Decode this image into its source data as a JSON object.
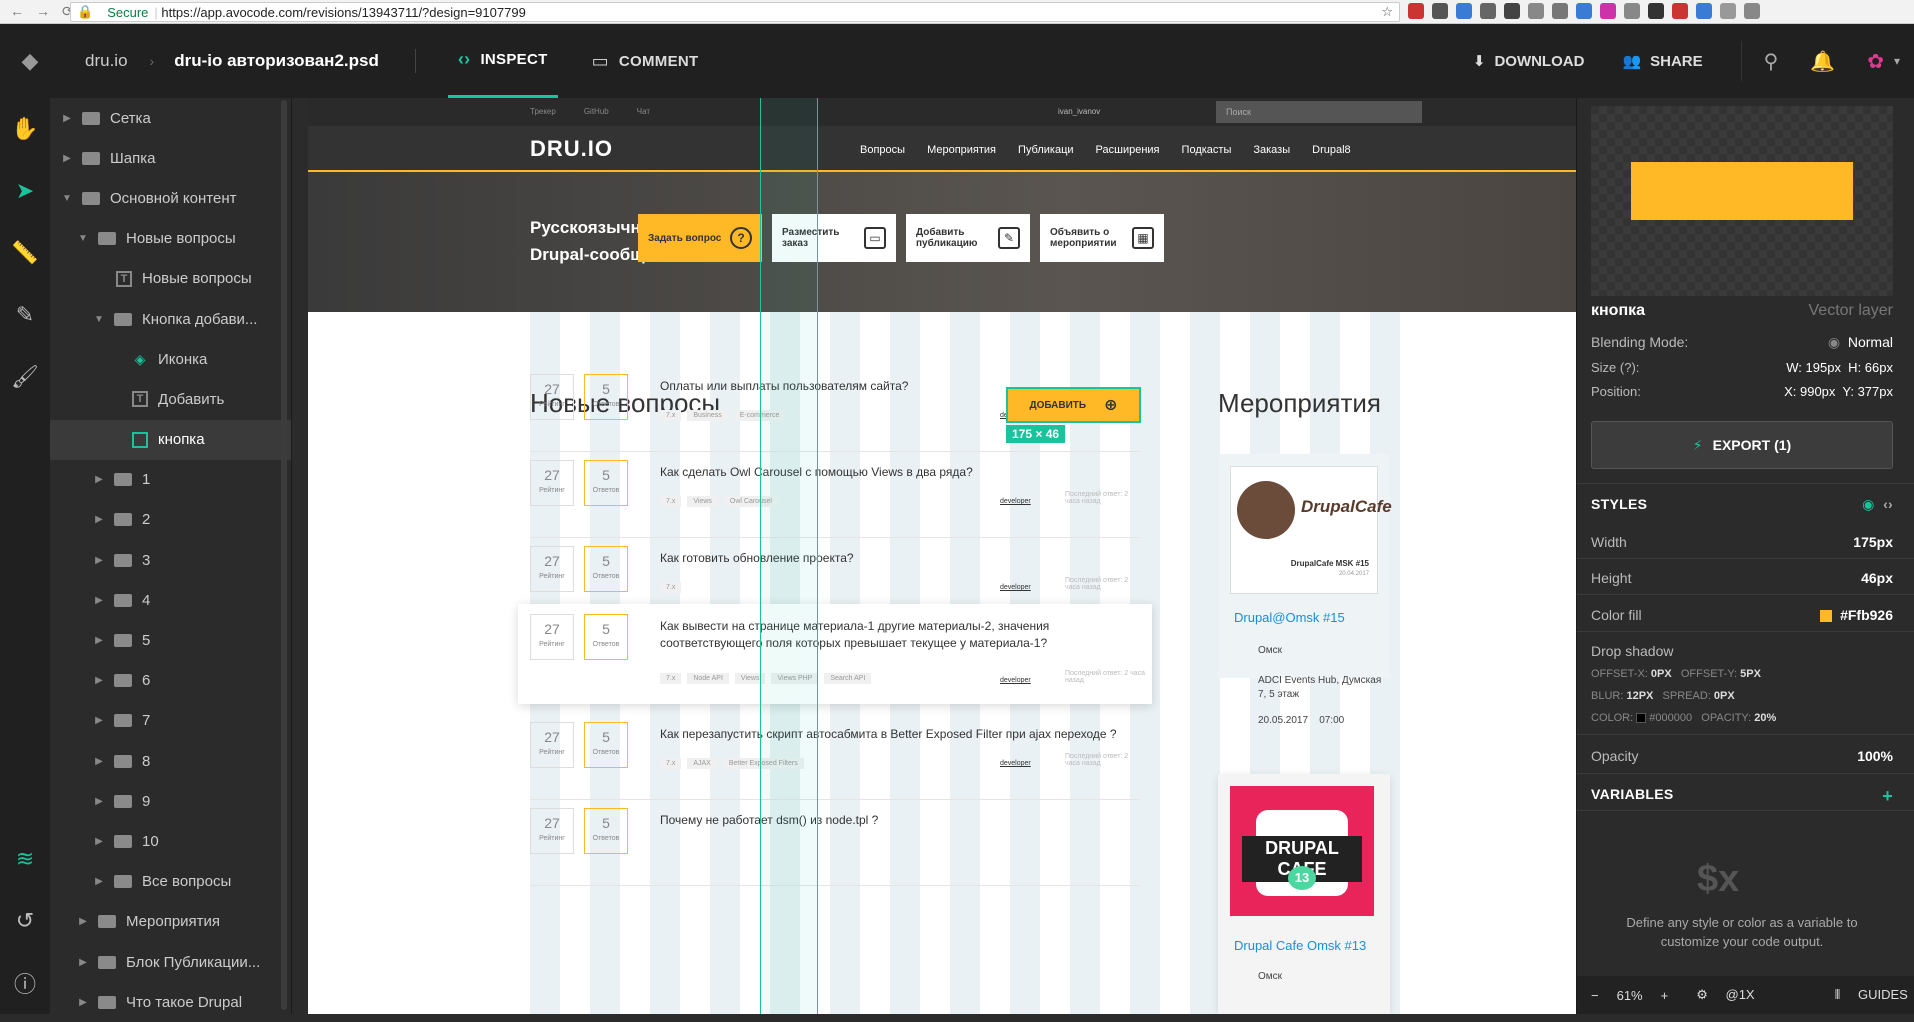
{
  "browser": {
    "secure_label": "Secure",
    "url": "https://app.avocode.com/revisions/13943711/?design=9107799"
  },
  "topbar": {
    "breadcrumb": [
      "dru.io",
      "dru-io авторизован2.psd"
    ],
    "tabs": [
      {
        "label": "INSPECT",
        "icon": "code-icon"
      },
      {
        "label": "COMMENT",
        "icon": "comment-icon"
      }
    ],
    "download_label": "DOWNLOAD",
    "share_label": "SHARE"
  },
  "layers": [
    {
      "label": "Сетка",
      "depth": 0,
      "type": "folder",
      "tri": "▶"
    },
    {
      "label": "Шапка",
      "depth": 0,
      "type": "folder",
      "tri": "▶"
    },
    {
      "label": "Основной контент",
      "depth": 0,
      "type": "folder",
      "tri": "▼"
    },
    {
      "label": "Новые вопросы",
      "depth": 1,
      "type": "folder",
      "tri": "▼"
    },
    {
      "label": "Новые вопросы",
      "depth": 2,
      "type": "text",
      "tri": ""
    },
    {
      "label": "Кнопка добави...",
      "depth": 2,
      "type": "folder",
      "tri": "▼"
    },
    {
      "label": "Иконка",
      "depth": 3,
      "type": "smart",
      "tri": ""
    },
    {
      "label": "Добавить",
      "depth": 3,
      "type": "text",
      "tri": ""
    },
    {
      "label": "кнопка",
      "depth": 3,
      "type": "vector",
      "tri": "",
      "selected": true
    },
    {
      "label": "1",
      "depth": 2,
      "type": "folder",
      "tri": "▶"
    },
    {
      "label": "2",
      "depth": 2,
      "type": "folder",
      "tri": "▶"
    },
    {
      "label": "3",
      "depth": 2,
      "type": "folder",
      "tri": "▶"
    },
    {
      "label": "4",
      "depth": 2,
      "type": "folder",
      "tri": "▶"
    },
    {
      "label": "5",
      "depth": 2,
      "type": "folder",
      "tri": "▶"
    },
    {
      "label": "6",
      "depth": 2,
      "type": "folder",
      "tri": "▶"
    },
    {
      "label": "7",
      "depth": 2,
      "type": "folder",
      "tri": "▶"
    },
    {
      "label": "8",
      "depth": 2,
      "type": "folder",
      "tri": "▶"
    },
    {
      "label": "9",
      "depth": 2,
      "type": "folder",
      "tri": "▶"
    },
    {
      "label": "10",
      "depth": 2,
      "type": "folder",
      "tri": "▶"
    },
    {
      "label": "Все вопросы",
      "depth": 2,
      "type": "folder",
      "tri": "▶"
    },
    {
      "label": "Мероприятия",
      "depth": 1,
      "type": "folder",
      "tri": "▶"
    },
    {
      "label": "Блок Публикации...",
      "depth": 1,
      "type": "folder",
      "tri": "▶"
    },
    {
      "label": "Что такое Drupal",
      "depth": 1,
      "type": "folder",
      "tri": "▶"
    }
  ],
  "site": {
    "top_links": [
      "Трекер",
      "GitHub",
      "Чат"
    ],
    "user": "ivan_ivanov",
    "search_placeholder": "Поиск",
    "logo": "DRU.IO",
    "menu": [
      "Вопросы",
      "Мероприятия",
      "Публикаци",
      "Расширения",
      "Подкасты",
      "Заказы",
      "Drupal8"
    ],
    "hero_title_1": "Русскоязычное",
    "hero_title_2": "Drupal-сообщество",
    "hero_buttons": [
      "Задать вопрос",
      "Разместить заказ",
      "Добавить публикацию",
      "Объявить о мероприятии"
    ],
    "new_questions": "Новые вопросы",
    "events": "Мероприятия",
    "add_button": "ДОБАВИТЬ",
    "dimension": "175 × 46",
    "rating_label": "Рейтинг",
    "answers_label": "Ответов",
    "questions": [
      {
        "rating": "27",
        "answers": "5",
        "title": "Оплаты или выплаты пользователям сайта?",
        "tags": [
          "7.x",
          "Business",
          "E-commerce"
        ]
      },
      {
        "rating": "27",
        "answers": "5",
        "title": "Как сделать Owl Carousel с помощью Views в два ряда?",
        "tags": [
          "7.x",
          "Views",
          "Owl Carousel"
        ]
      },
      {
        "rating": "27",
        "answers": "5",
        "title": "Как готовить обновление проекта?",
        "tags": [
          "7.x"
        ]
      },
      {
        "rating": "27",
        "answers": "5",
        "title": "Как вывести на странице материала-1 другие материалы-2, значения соответствующего поля которых превышает текущее у материала-1?",
        "tags": [
          "7.x",
          "Node API",
          "Views",
          "Views PHP",
          "Search API"
        ]
      },
      {
        "rating": "27",
        "answers": "5",
        "title": "Как перезапустить скрипт автосабмита в Better Exposed Filter при ajax переходе ?",
        "tags": [
          "7.x",
          "AJAX",
          "Better Exposed Filters"
        ]
      },
      {
        "rating": "27",
        "answers": "5",
        "title": "Почему не работает dsm() из node.tpl ?",
        "tags": []
      }
    ],
    "author": "developer",
    "last_answer": "Последний ответ: 2 часа назад",
    "event1": {
      "card": "DrupalCafe",
      "card_sub": "DrupalCafe MSK #15",
      "card_date": "20.04.2017",
      "title": "Drupal@Omsk #15",
      "city": "Омск",
      "place": "ADCI Events Hub, Думская 7, 5 этаж",
      "date": "20.05.2017",
      "time": "07:00"
    },
    "event2": {
      "card": "DRUPAL CAFE",
      "card_num": "13",
      "title": "Drupal Cafe Omsk #13",
      "city": "Омск"
    }
  },
  "inspector": {
    "layer_name": "кнопка",
    "layer_type": "Vector layer",
    "blending_label": "Blending Mode:",
    "blending_value": "Normal",
    "size_label": "Size",
    "size_w": "195px",
    "size_h": "66px",
    "position_label": "Position:",
    "pos_x": "990px",
    "pos_y": "377px",
    "export_label": "EXPORT (1)",
    "styles_label": "STYLES",
    "width_label": "Width",
    "width_value": "175px",
    "height_label": "Height",
    "height_value": "46px",
    "fill_label": "Color fill",
    "fill_value": "#Ffb926",
    "fill_color": "#ffb926",
    "shadow_label": "Drop shadow",
    "offx": "0PX",
    "offy": "5PX",
    "blur": "12PX",
    "spread": "0PX",
    "color": "#000000",
    "opacity_s": "20%",
    "opacity_label": "Opacity",
    "opacity_value": "100%",
    "variables_label": "VARIABLES",
    "var_help": "Define any style or color as a variable to customize your code output.",
    "zoom": "61%",
    "scale": "@1X",
    "guides": "GUIDES"
  }
}
